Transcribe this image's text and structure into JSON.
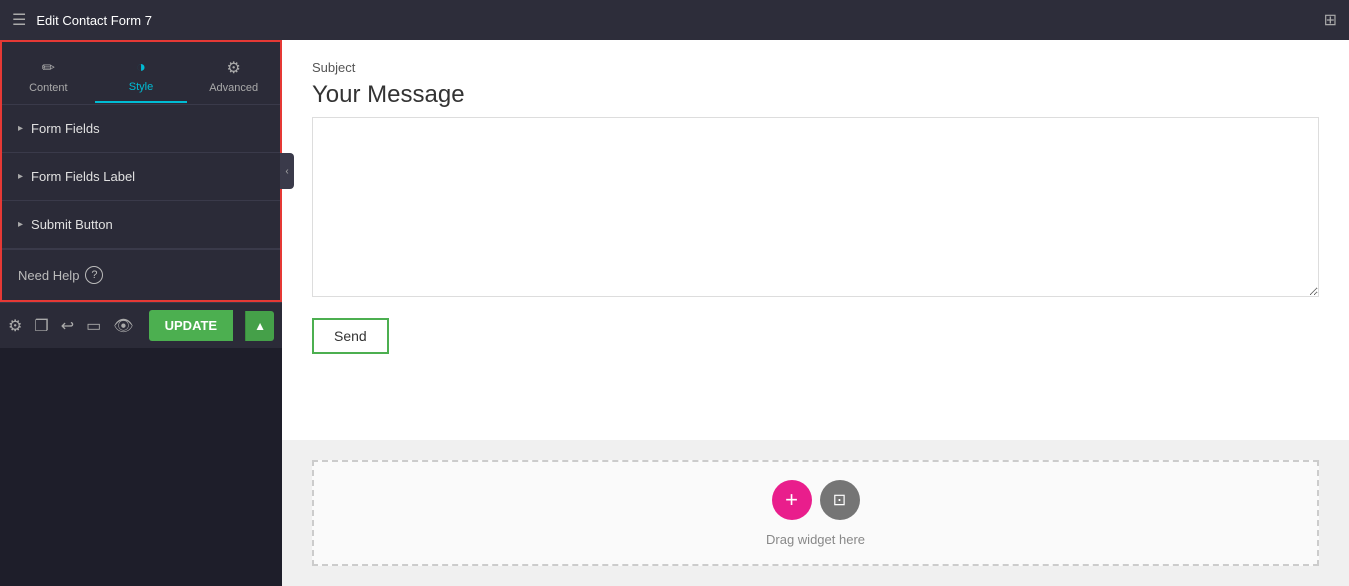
{
  "header": {
    "title": "Edit Contact Form 7",
    "hamburger": "☰",
    "grid": "⊞"
  },
  "tabs": [
    {
      "id": "content",
      "label": "Content",
      "icon": "✏️",
      "active": false
    },
    {
      "id": "style",
      "label": "Style",
      "icon": "◑",
      "active": true
    },
    {
      "id": "advanced",
      "label": "Advanced",
      "icon": "⚙",
      "active": false
    }
  ],
  "accordion": [
    {
      "id": "form-fields",
      "label": "Form Fields"
    },
    {
      "id": "form-fields-label",
      "label": "Form Fields Label"
    },
    {
      "id": "submit-button",
      "label": "Submit Button"
    }
  ],
  "sidebar_bottom": {
    "help_label": "Need Help",
    "help_icon": "?"
  },
  "footer": {
    "update_label": "UPDATE",
    "arrow": "▲"
  },
  "canvas": {
    "subject_label": "Subject",
    "message_label": "Your Message",
    "message_placeholder": "",
    "send_label": "Send",
    "drop_text": "Drag widget here"
  },
  "icons": {
    "gear": "⚙",
    "layers": "❐",
    "undo": "↩",
    "monitor": "▭",
    "eye": "👁",
    "chevron_right": "▸",
    "chevron_left": "‹",
    "plus": "+",
    "folder": "⊡"
  }
}
